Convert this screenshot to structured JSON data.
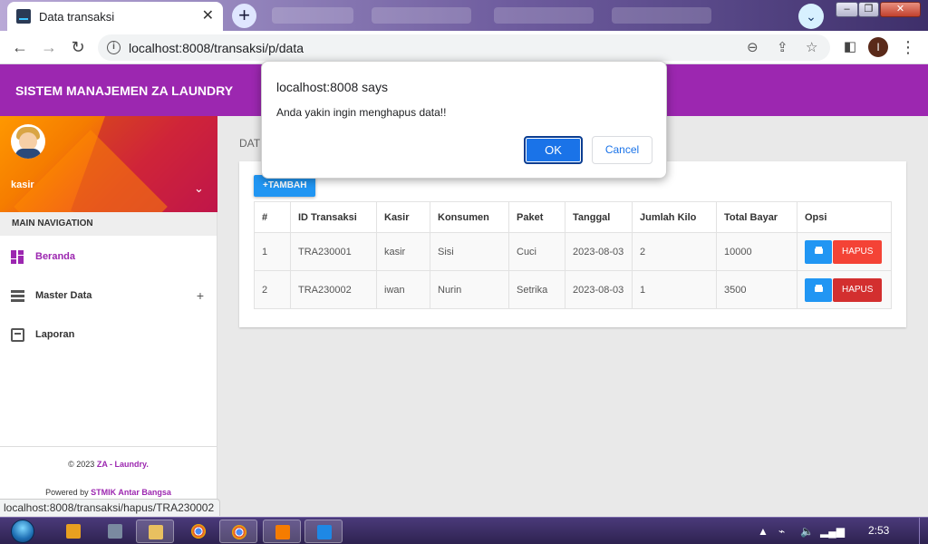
{
  "browser": {
    "tab_title": "Data transaksi",
    "url": "localhost:8008/transaksi/p/data",
    "profile_initial": "I",
    "status_url": "localhost:8008/transaksi/hapus/TRA230002"
  },
  "app": {
    "brand": "SISTEM MANAJEMEN ZA LAUNDRY",
    "accent_color": "#9c27b0",
    "user_name": "kasir",
    "nav_header": "MAIN NAVIGATION",
    "nav_items": [
      {
        "label": "Beranda",
        "icon": "dashboard-icon",
        "active": true
      },
      {
        "label": "Master Data",
        "icon": "list-icon",
        "expandable": true
      },
      {
        "label": "Laporan",
        "icon": "clipboard-icon"
      }
    ],
    "footer": {
      "copyright_prefix": "© 2023",
      "copyright_brand": "ZA - Laundry.",
      "powered_prefix": "Powered by",
      "powered_by": "STMIK Antar Bangsa"
    }
  },
  "content": {
    "section_title": "DAT",
    "add_button": "+TAMBAH",
    "columns": [
      "#",
      "ID Transaksi",
      "Kasir",
      "Konsumen",
      "Paket",
      "Tanggal",
      "Jumlah Kilo",
      "Total Bayar",
      "Opsi"
    ],
    "rows": [
      {
        "no": "1",
        "id": "TRA230001",
        "kasir": "kasir",
        "konsumen": "Sisi",
        "paket": "Cuci",
        "tanggal": "2023-08-03",
        "kilo": "2",
        "total": "10000",
        "hapus": "HAPUS"
      },
      {
        "no": "2",
        "id": "TRA230002",
        "kasir": "iwan",
        "konsumen": "Nurin",
        "paket": "Setrika",
        "tanggal": "2023-08-03",
        "kilo": "1",
        "total": "3500",
        "hapus": "HAPUS"
      }
    ]
  },
  "dialog": {
    "title": "localhost:8008 says",
    "message": "Anda yakin ingin menghapus data!!",
    "ok": "OK",
    "cancel": "Cancel"
  },
  "taskbar": {
    "clock": "2:53",
    "apps": [
      "media-player-icon",
      "network-icon",
      "file-explorer-icon",
      "chrome-icon",
      "chrome-icon",
      "xampp-icon",
      "vscode-icon"
    ]
  }
}
